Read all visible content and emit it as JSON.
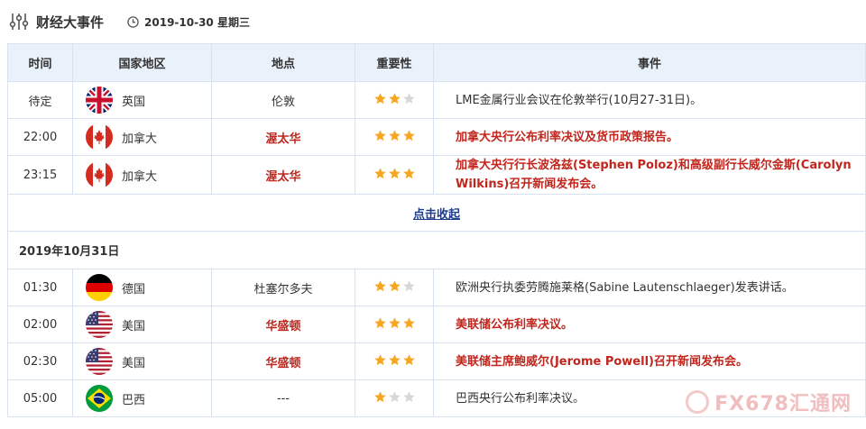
{
  "header": {
    "title": "财经大事件",
    "date": "2019-10-30 星期三"
  },
  "columns": [
    "时间",
    "国家地区",
    "地点",
    "重要性",
    "事件"
  ],
  "colors": {
    "highlight_red": "#c0261d",
    "header_bg": "#e9f1fb",
    "border": "#d7e2ee",
    "star": "#f5a623",
    "star_empty": "#d8d8d8"
  },
  "group1": [
    {
      "time": "待定",
      "country": "英国",
      "flag": "uk-flag-icon",
      "location": "伦敦",
      "importance": 2,
      "event": "LME金属行业会议在伦敦举行(10月27-31日)。",
      "highlight": false
    },
    {
      "time": "22:00",
      "country": "加拿大",
      "flag": "canada-flag-icon",
      "location": "渥太华",
      "importance": 3,
      "event": "加拿大央行公布利率决议及货币政策报告。",
      "highlight": true
    },
    {
      "time": "23:15",
      "country": "加拿大",
      "flag": "canada-flag-icon",
      "location": "渥太华",
      "importance": 3,
      "event": "加拿大央行行长波洛兹(Stephen Poloz)和高级副行长威尔金斯(Carolyn Wilkins)召开新闻发布会。",
      "highlight": true
    }
  ],
  "collapse_label": "点击收起",
  "date_row": "2019年10月31日",
  "group2": [
    {
      "time": "01:30",
      "country": "德国",
      "flag": "germany-flag-icon",
      "location": "杜塞尔多夫",
      "importance": 2,
      "event": "欧洲央行执委劳腾施莱格(Sabine Lautenschlaeger)发表讲话。",
      "highlight": false
    },
    {
      "time": "02:00",
      "country": "美国",
      "flag": "usa-flag-icon",
      "location": "华盛顿",
      "importance": 3,
      "event": "美联储公布利率决议。",
      "highlight": true
    },
    {
      "time": "02:30",
      "country": "美国",
      "flag": "usa-flag-icon",
      "location": "华盛顿",
      "importance": 3,
      "event": "美联储主席鲍威尔(Jerome Powell)召开新闻发布会。",
      "highlight": true
    },
    {
      "time": "05:00",
      "country": "巴西",
      "flag": "brazil-flag-icon",
      "location": "---",
      "importance": 1,
      "event": "巴西央行公布利率决议。",
      "highlight": false
    }
  ],
  "watermark": "FX678汇通网"
}
